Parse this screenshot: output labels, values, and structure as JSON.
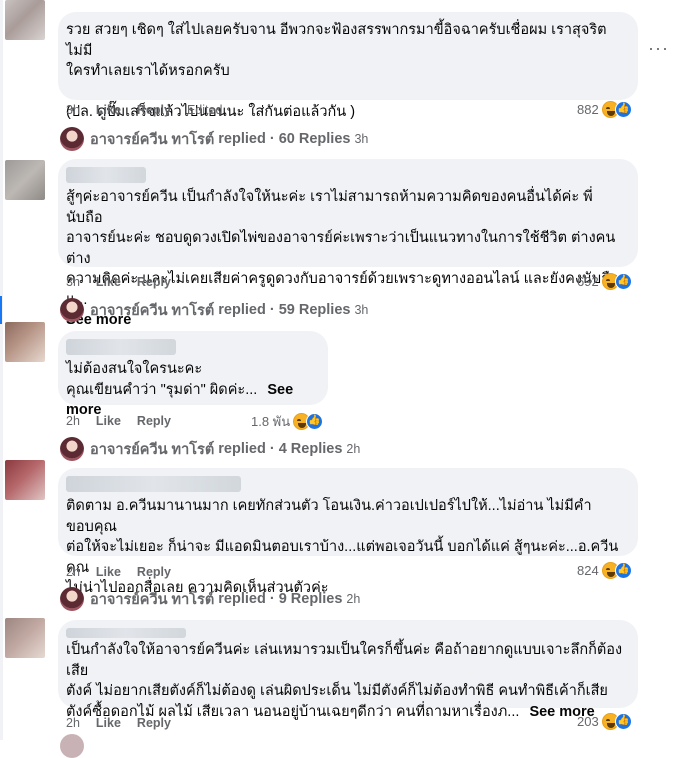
{
  "comments": [
    {
      "text": "รวย สวยๆ เชิดๆ ใส่ไปเลยครับจาน อีพวกจะฟ้องสรรพากรมาขี้อิจฉาครับเชื่อผม เราสุจริตไม่มี\nใครทำเลยเราได้หรอกครับ\n\n(ปล. ดูปั๊มเสร็จแล้วไปนอนนะ ใส่กันต่อแล้วกัน )",
      "see_more": "",
      "time": "3h",
      "like": "Like",
      "reply": "Reply",
      "edited": "Edited",
      "reactions": "882",
      "replies": {
        "author": "อาจารย์ควีน ทาโรต์",
        "label": "replied",
        "count": "60 Replies",
        "time": "3h"
      }
    },
    {
      "text": "สู้ๆค่ะอาจารย์ควีน เป็นกำลังใจให้นะค่ะ เราไม่สามารถห้ามความคิดของคนอื่นได้ค่ะ พี่นับถือ\nอาจารย์นะค่ะ ชอบดูดวงเปิดไพ่ของอาจารย์ค่ะเพราะว่าเป็นแนวทางในการใช้ชีวิต ต่างคนต่าง\nความคิดค่ะ และไม่เคยเสียค่าครูดูดวงกับอาจารย์ด้วยเพราะดูทางออนไลน์ และยังคงนับถือแ...",
      "see_more": "See more",
      "time": "3h",
      "like": "Like",
      "reply": "Reply",
      "reactions": "692",
      "replies": {
        "author": "อาจารย์ควีน ทาโรต์",
        "label": "replied",
        "count": "59 Replies",
        "time": "3h"
      }
    },
    {
      "text": "ไม่ต้องสนใจใครนะคะ\nคุณเขียนคำว่า \"รุมด่า\" ผิดค่ะ...",
      "see_more": "See more",
      "time": "2h",
      "like": "Like",
      "reply": "Reply",
      "reactions": "1.8 พัน",
      "replies": {
        "author": "อาจารย์ควีน ทาโรต์",
        "label": "replied",
        "count": "4 Replies",
        "time": "2h"
      }
    },
    {
      "text": "ติดตาม อ.ควีนมานานมาก เคยทักส่วนตัว โอนเงิน.ค่าวอเปเปอร์ไปให้...ไม่อ่าน ไม่มีคำขอบคุณ\nต่อให้จะไม่เยอะ ก็น่าจะ มีแอดมินตอบเราบ้าง...แต่พอเจอวันนี้ บอกได้แค่ สู้ๆนะค่ะ...อ.ควีน คุณ\nไม่น่าไปออกสื่อเลย ความคิดเห็นส่วนตัวค่ะ",
      "see_more": "",
      "time": "2h",
      "like": "Like",
      "reply": "Reply",
      "reactions": "824",
      "replies": {
        "author": "อาจารย์ควีน ทาโรต์",
        "label": "replied",
        "count": "9 Replies",
        "time": "2h"
      }
    },
    {
      "text": "เป็นกำลังใจให้อาจารย์ควีนค่ะ เล่นเหมารวมเป็นใครก็ขึ้นค่ะ คือถ้าอยากดูแบบเจาะลึกก็ต้องเสีย\nตังค์ ไม่อยากเสียตังค์ก็ไม่ต้องดู เล่นผิดประเด็น ไม่มีตังค์ก็ไม่ต้องทำพิธี คนทำพิธีเค้าก็เสีย\nตังค์ซื้อดอกไม้ ผลไม้ เสียเวลา นอนอยู่บ้านเฉยๆดีกว่า คนที่ถามหาเรื่องภ...",
      "see_more": "See more",
      "time": "2h",
      "like": "Like",
      "reply": "Reply",
      "reactions": "203"
    }
  ]
}
